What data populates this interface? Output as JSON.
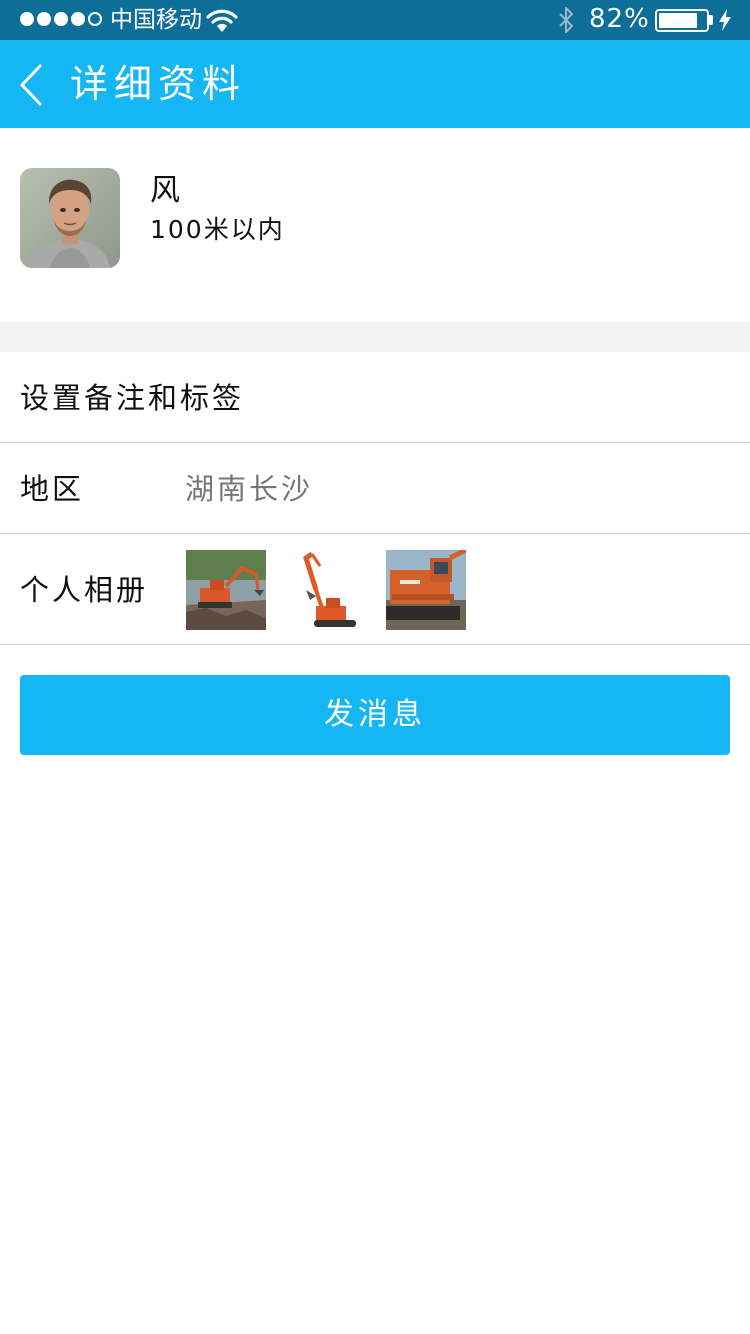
{
  "status_bar": {
    "carrier": "中国移动",
    "battery_text": "82%",
    "battery_level": 0.82,
    "signal_dots": [
      true,
      true,
      true,
      true,
      false
    ],
    "icons": [
      "signal-dots",
      "wifi-icon",
      "bluetooth-icon",
      "battery-icon",
      "charging-bolt-icon"
    ]
  },
  "nav": {
    "title": "详细资料",
    "back_icon": "chevron-left-icon",
    "color": "#15b6f4"
  },
  "profile": {
    "name": "风",
    "distance": "100米以内",
    "avatar_icon": "user-photo"
  },
  "rows": {
    "remark_label": "设置备注和标签",
    "region_label": "地区",
    "region_value": "湖南长沙",
    "album_label": "个人相册",
    "album_photos": [
      "excavator-photo-1",
      "excavator-photo-2",
      "excavator-photo-3"
    ]
  },
  "actions": {
    "send_message": "发消息"
  },
  "colors": {
    "accent": "#15b6f4",
    "status_bar": "#0e6e9a",
    "separator": "#f2f2f2"
  }
}
